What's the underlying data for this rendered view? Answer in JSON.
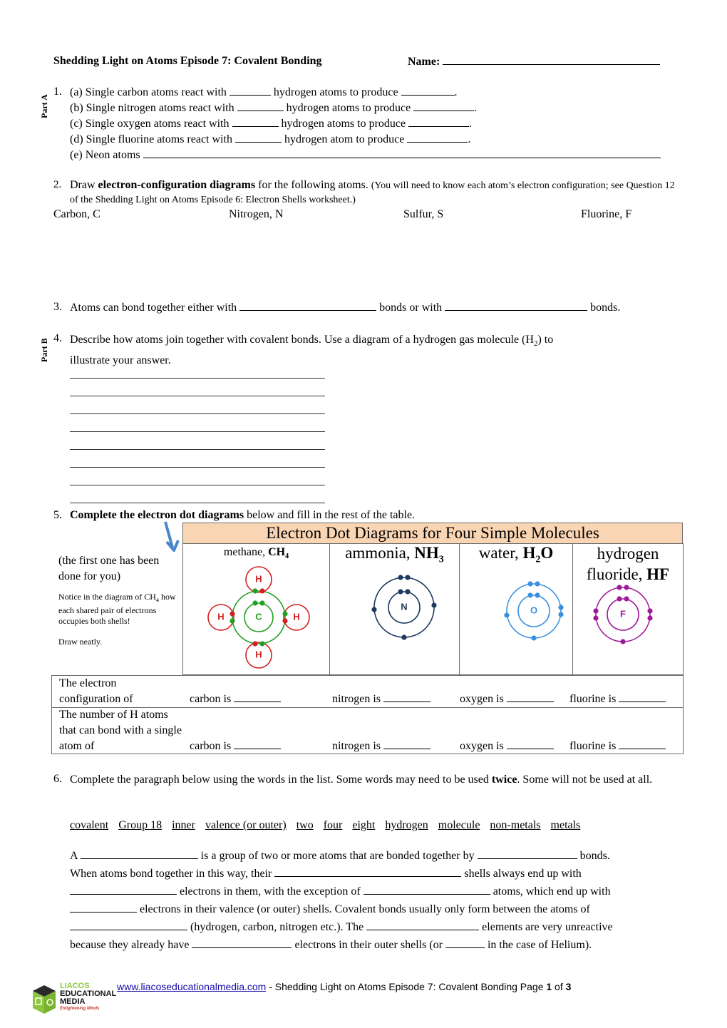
{
  "header": {
    "title": "Shedding Light on Atoms Episode 7: Covalent Bonding",
    "name_label": "Name:"
  },
  "sections": {
    "part_a": "Part A",
    "part_b": "Part B"
  },
  "q1": {
    "number": "1.",
    "items": [
      {
        "pre": "(a) Single carbon atoms react with",
        "mid": "hydrogen atoms to produce",
        "end": "."
      },
      {
        "pre": "(b) Single nitrogen atoms react with",
        "mid": "hydrogen atoms to produce",
        "end": "."
      },
      {
        "pre": "(c) Single oxygen atoms react with",
        "mid": "hydrogen atoms to produce",
        "end": "."
      },
      {
        "pre": "(d) Single fluorine atoms react with",
        "mid": "hydrogen atom to produce",
        "end": "."
      }
    ],
    "e_label": "(e) Neon atoms"
  },
  "q2": {
    "number": "2.",
    "text_pre": "Draw ",
    "text_bold": "electron-configuration diagrams",
    "text_post": " for the following atoms.",
    "note": "(You will need to know each atom’s electron configuration; see Question 12 of the Shedding Light on Atoms Episode 6: Electron Shells worksheet.)",
    "atoms": [
      "Carbon, C",
      "Nitrogen, N",
      "Sulfur, S",
      "Fluorine, F"
    ]
  },
  "q3": {
    "number": "3.",
    "pre": "Atoms can bond together either with",
    "mid": "bonds or with",
    "end": "bonds."
  },
  "q4": {
    "number": "4.",
    "text": "Describe how atoms join together with covalent bonds. Use a diagram of a hydrogen gas molecule (H",
    "sub": "2",
    "text2": ") to",
    "line2": "illustrate your answer.",
    "answer_lines": 8
  },
  "q5": {
    "number": "5.",
    "bold": "Complete the electron dot diagrams",
    "rest": " below and fill in the rest of the table.",
    "table_title": "Electron Dot Diagrams for Four Simple Molecules",
    "side_note1": "(the first one has been done for you)",
    "side_note2_pre": "Notice in the diagram of CH",
    "side_note2_sub": "4",
    "side_note2_post": " how each shared pair of electrons occupies both shells!",
    "side_note3": "Draw neatly.",
    "molecules": [
      {
        "name": "methane, ",
        "formula": "CH",
        "sub": "4",
        "center": "C",
        "outer": "H",
        "color": "#22a022",
        "h_color": "#d42020"
      },
      {
        "name": "ammonia, ",
        "formula": "NH",
        "sub": "3",
        "center": "N",
        "color": "#1f3a5f"
      },
      {
        "name": "water, ",
        "formula": "H",
        "sub": "2",
        "formula2": "O",
        "center": "O",
        "color": "#3b8fe0"
      },
      {
        "name": "hydrogen fluoride, ",
        "formula": "HF",
        "center": "F",
        "color": "#a0189a"
      }
    ],
    "rows": [
      {
        "label": "The electron configuration of",
        "cells": [
          "carbon is",
          "nitrogen is",
          "oxygen is",
          "fluorine is"
        ]
      },
      {
        "label": "The number of H atoms that can bond with a single atom of",
        "cells": [
          "carbon is",
          "nitrogen is",
          "oxygen is",
          "fluorine is"
        ]
      }
    ],
    "header_color": "#fad5b3",
    "arrow_color": "#4a86c8"
  },
  "q6": {
    "number": "6.",
    "pre": "Complete the paragraph below using the words in the list. Some words may need to be used ",
    "bold": "twice",
    "post": ". Some will not be used at all.",
    "words": [
      "covalent",
      "Group 18",
      "inner",
      "valence (or outer)",
      "two",
      "four",
      "eight",
      "hydrogen",
      "molecule",
      "non-metals",
      "metals"
    ],
    "paragraph": [
      "A",
      "is a group of two or more atoms that are bonded together by",
      "bonds.",
      "When atoms bond together in this way, their",
      "shells always end up with",
      "electrons in them, with the exception of",
      "atoms, which end up with",
      "electrons in their valence (or outer) shells. Covalent bonds usually only form between the atoms of",
      "(hydrogen, carbon, nitrogen etc.). The",
      "elements are very unreactive",
      "because they already have",
      "electrons in their outer shells (or",
      "in the case of Helium)."
    ]
  },
  "footer": {
    "logo_line1": "LIACOS",
    "logo_line2": "EDUCATIONAL",
    "logo_line3": "MEDIA",
    "logo_tagline": "Enlightening Minds",
    "url": "www.liacoseducationalmedia.com",
    "text": " - Shedding Light on Atoms Episode 7: Covalent Bonding  Page ",
    "page": "1",
    "of": " of ",
    "total": "3"
  }
}
